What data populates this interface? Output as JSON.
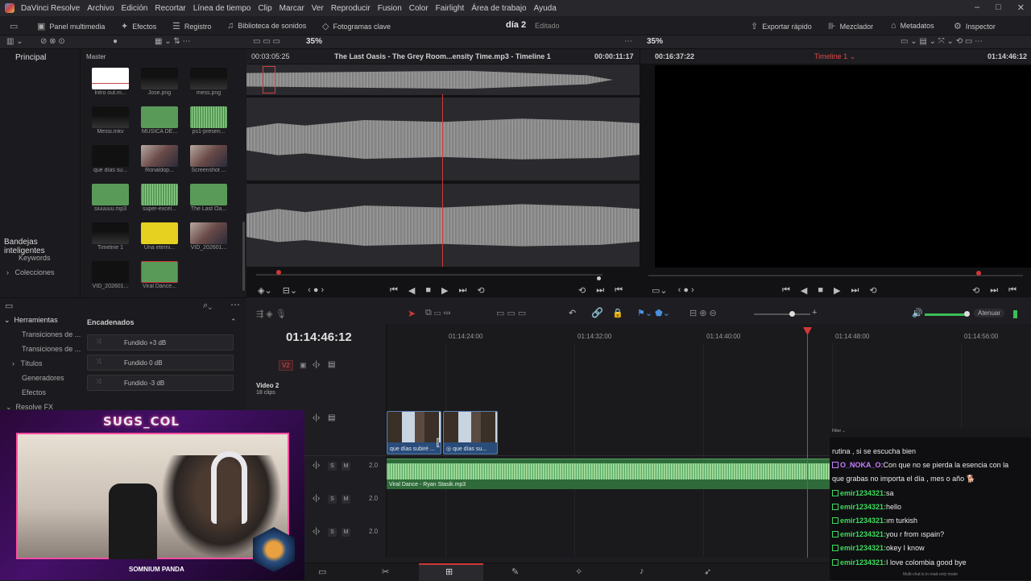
{
  "menubar": {
    "app": "DaVinci Resolve",
    "items": [
      "Archivo",
      "Edición",
      "Recortar",
      "Línea de tiempo",
      "Clip",
      "Marcar",
      "Ver",
      "Reproducir",
      "Fusion",
      "Color",
      "Fairlight",
      "Área de trabajo",
      "Ayuda"
    ]
  },
  "toolbar": {
    "media_pool": "Panel multimedia",
    "effects": "Efectos",
    "index": "Registro",
    "sound_library": "Biblioteca de sonidos",
    "keyframes": "Fotogramas clave",
    "project": "día 2",
    "status": "Editado",
    "quick_export": "Exportar rápido",
    "mixer": "Mezclador",
    "metadata": "Metadatos",
    "inspector": "Inspector"
  },
  "subbar": {
    "zoom_left": "35%",
    "zoom_right": "35%"
  },
  "bins": {
    "master": "Principal",
    "smart_bins": "Bandejas inteligentes",
    "keywords": "Keywords",
    "collections": "Colecciones",
    "pool_title": "Master"
  },
  "media": [
    {
      "name": "Intro out.m...",
      "kind": "white"
    },
    {
      "name": "Jose.png",
      "kind": "dark"
    },
    {
      "name": "mess.png",
      "kind": "dark"
    },
    {
      "name": "Messi.mkv",
      "kind": "dark"
    },
    {
      "name": "MUSICA DE...",
      "kind": "green"
    },
    {
      "name": "ps1-presen...",
      "kind": "wave"
    },
    {
      "name": "que días su...",
      "kind": "black"
    },
    {
      "name": "Ronaldop...",
      "kind": "photo"
    },
    {
      "name": "Screenshot ...",
      "kind": "photo"
    },
    {
      "name": "siuuuuu.mp3",
      "kind": "green"
    },
    {
      "name": "super-excel...",
      "kind": "wave"
    },
    {
      "name": "The Last Oa...",
      "kind": "green"
    },
    {
      "name": "Timeline 1",
      "kind": "dark"
    },
    {
      "name": "Una eterni...",
      "kind": "yellow"
    },
    {
      "name": "VID_202601...",
      "kind": "photo"
    },
    {
      "name": "VID_202601...",
      "kind": "black"
    },
    {
      "name": "Viral Dance...",
      "kind": "green"
    }
  ],
  "source": {
    "tc_left": "00:03:05:25",
    "title": "The Last Oasis - The Grey Room...ensity  Time.mp3 - Timeline 1",
    "duration": "00:00:11:17"
  },
  "program": {
    "tc_left": "00:16:37:22",
    "timeline": "Timeline 1",
    "tc_right": "01:14:46:12"
  },
  "effects": {
    "toolbox": "Herramientas",
    "transitions_video": "Transiciones de ...",
    "transitions_audio": "Transiciones de ...",
    "titles": "Títulos",
    "generators": "Generadores",
    "effects": "Efectos",
    "resolve_fx": "Resolve FX",
    "section": "Encadenados",
    "items": [
      "Fundido +3 dB",
      "Fundido 0 dB",
      "Fundido -3 dB"
    ]
  },
  "timeline": {
    "timecode": "01:14:46:12",
    "ruler": [
      "01:14:24:00",
      "01:14:32:00",
      "01:14:40:00",
      "01:14:48:00",
      "01:14:56:00"
    ],
    "v2": "V2",
    "video2": "Video 2",
    "clips": "18 clips",
    "vclips": [
      "que días subiré ...",
      "que días su..."
    ],
    "audio_clip": "Viral Dance - Ryan Stasik.mp3",
    "a_level": "2.0",
    "attenuate": "Atenuar"
  },
  "stream": {
    "channel": "SUGS_COL",
    "sponsor": "SOMNIUM PANDA"
  },
  "chat": {
    "filter": "Filter",
    "lines": [
      {
        "user": "",
        "text": "rutina , si se escucha bien"
      },
      {
        "user": "O_NOKA_O:",
        "text": "Con que no se pierda la esencia con la",
        "color": "#c77dff"
      },
      {
        "user": "",
        "text": "que grabas no importa el día , mes o año 🐕"
      },
      {
        "user": "emir1234321:",
        "text": "sa",
        "color": "#3ddc5c"
      },
      {
        "user": "emir1234321:",
        "text": "hello",
        "color": "#3ddc5c"
      },
      {
        "user": "emir1234321:",
        "text": "ım turkish",
        "color": "#3ddc5c"
      },
      {
        "user": "emir1234321:",
        "text": "you r from ıspain?",
        "color": "#3ddc5c"
      },
      {
        "user": "emir1234321:",
        "text": "okey I know",
        "color": "#3ddc5c"
      },
      {
        "user": "emir1234321:",
        "text": "I love colombia good bye",
        "color": "#3ddc5c"
      }
    ],
    "footer": "Multi-chat is in read-only mode"
  }
}
